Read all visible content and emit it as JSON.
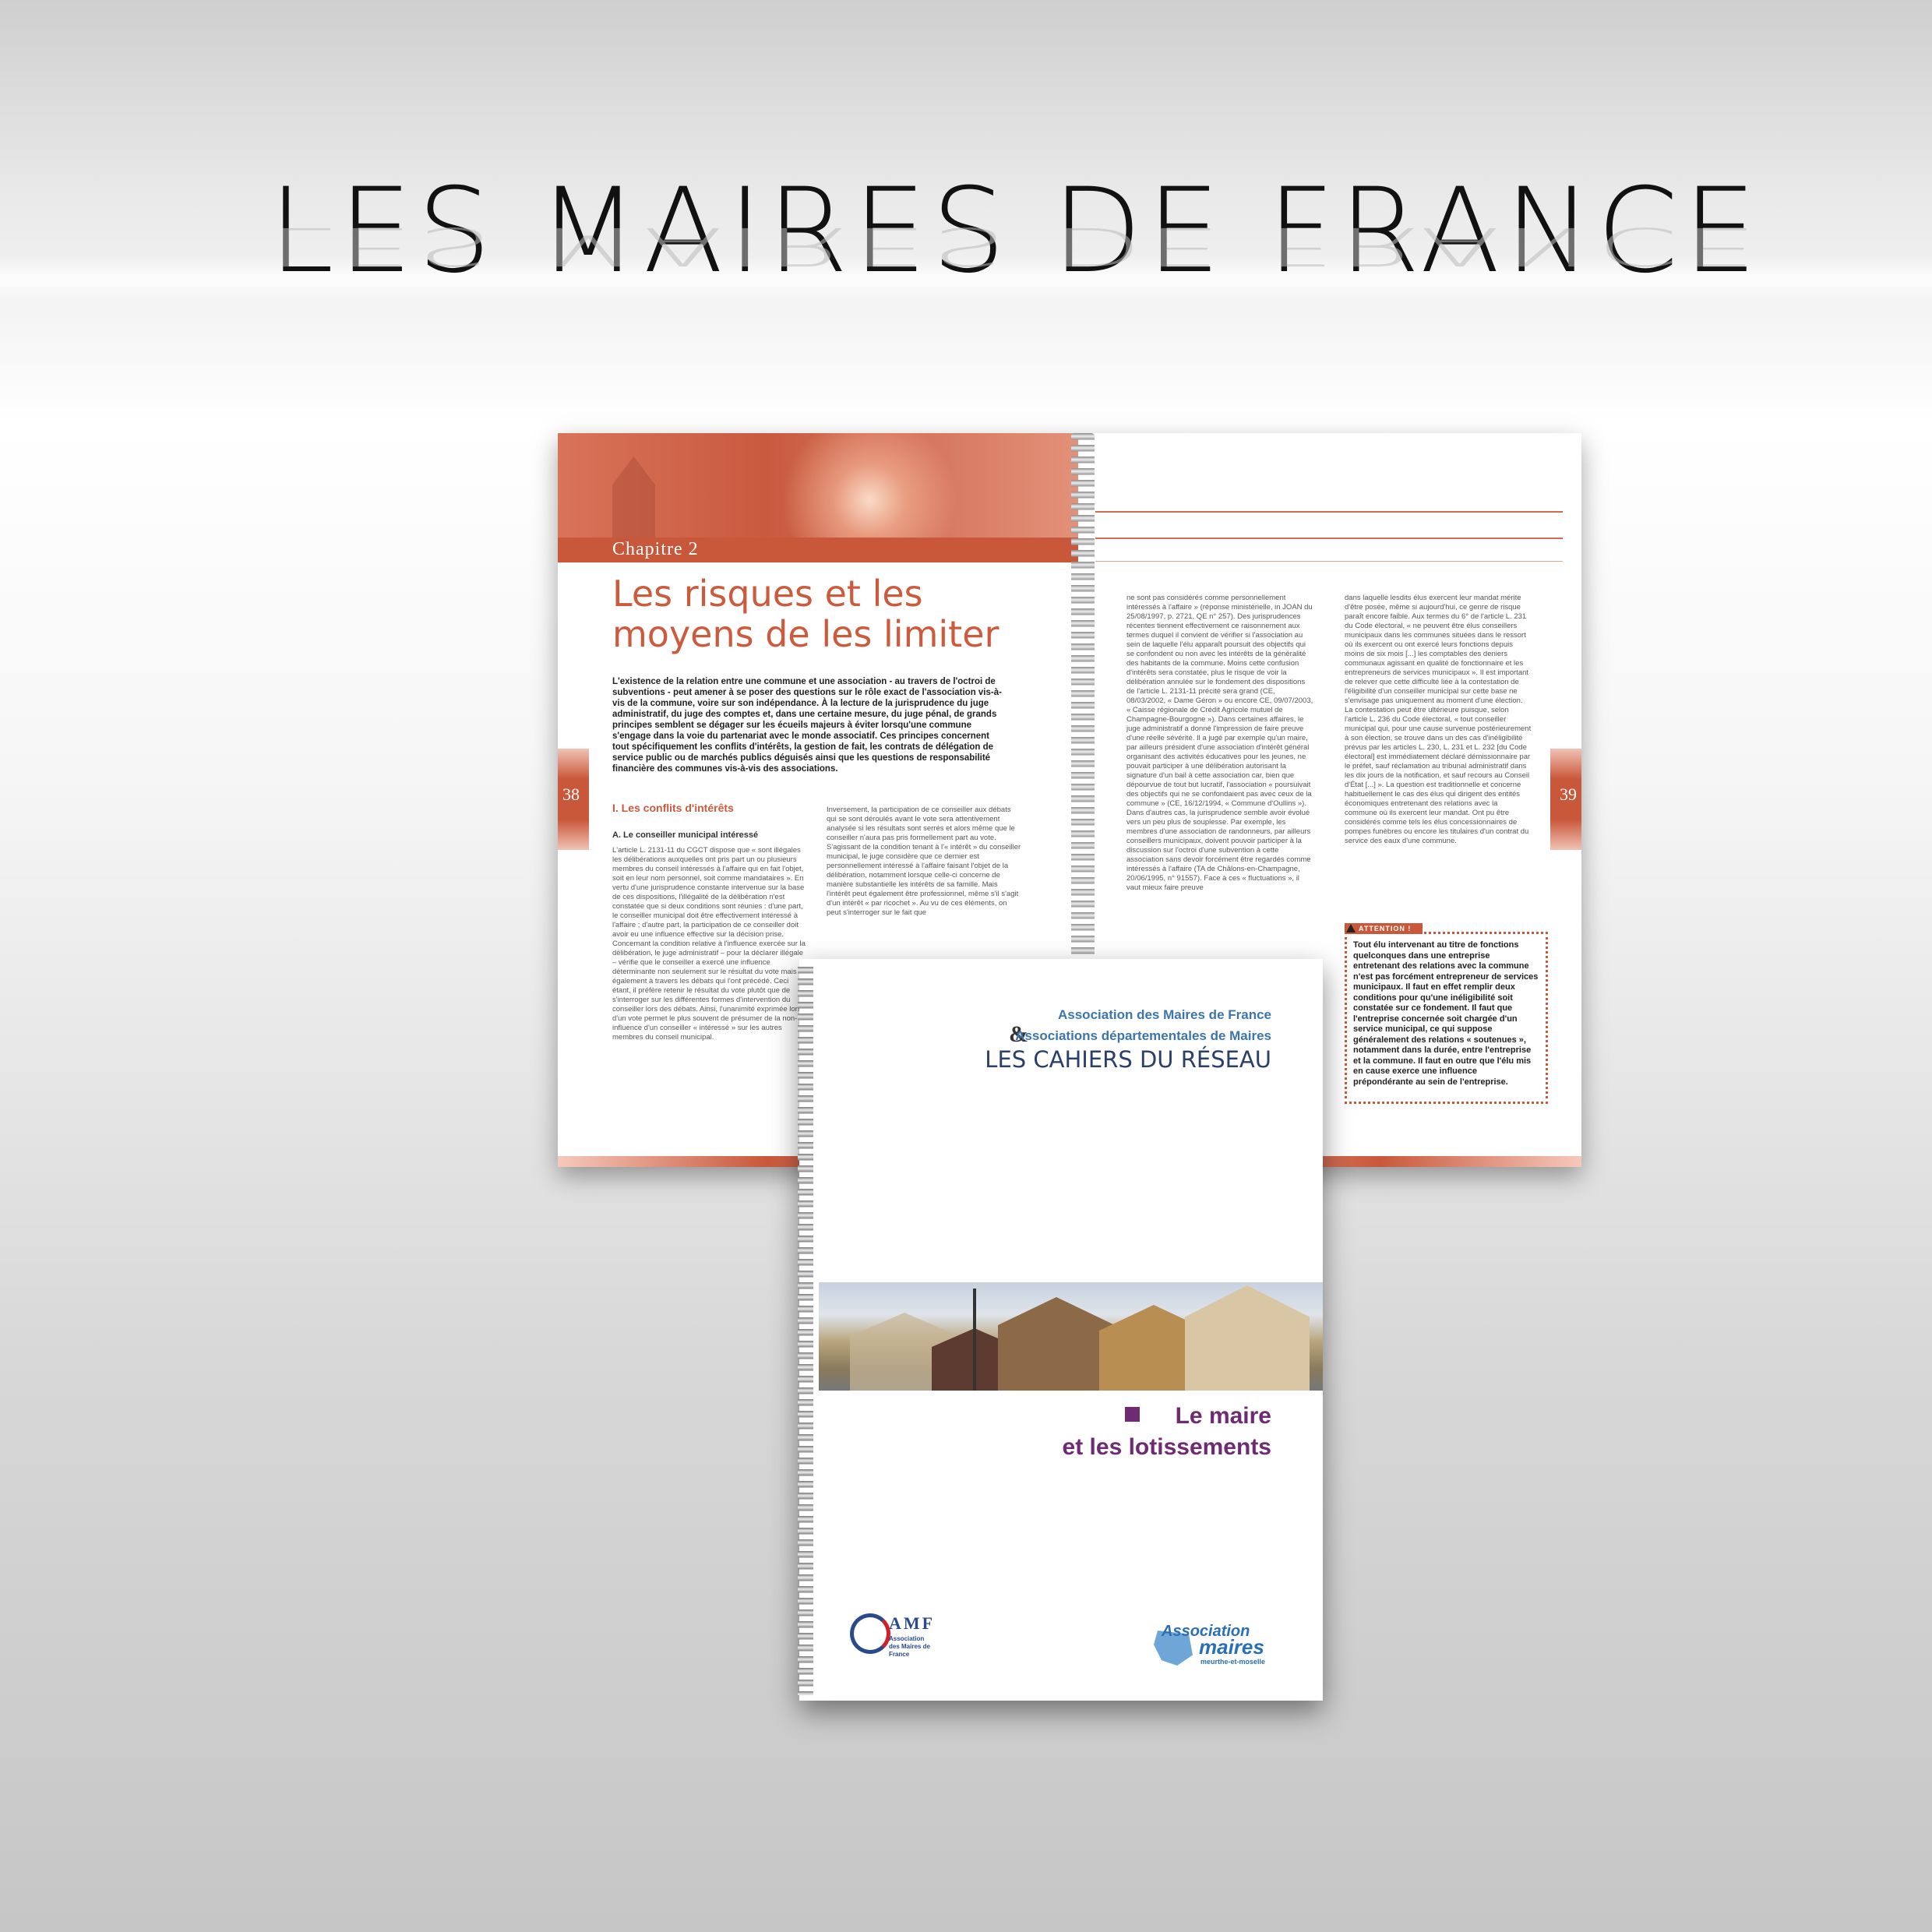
{
  "headline": "LES MAIRES DE FRANCE",
  "spread": {
    "chapter": "Chapitre 2",
    "title": "Les risques et les moyens de les limiter",
    "intro": "L'existence de la relation entre une commune et une association - au travers de l'octroi de subventions - peut amener à se poser des questions sur le rôle exact de l'association vis-à-vis de la commune, voire sur son indépendance. À la lecture de la jurisprudence du juge administratif, du juge des comptes et, dans une certaine mesure, du juge pénal, de grands principes semblent se dégager sur les écueils majeurs à éviter lorsqu'une commune s'engage dans la voie du partenariat avec le monde associatif. Ces principes concernent tout spécifiquement les conflits d'intérêts, la gestion de fait, les contrats de délégation de service public ou de marchés publics déguisés ainsi que les questions de responsabilité financière des communes vis-à-vis des associations.",
    "page_left": "38",
    "page_right": "39",
    "section": "I. Les conflits d'intérêts",
    "subsection": "A. Le conseiller municipal intéressé",
    "col1": "L'article L. 2131-11 du CGCT dispose que « sont illégales les délibérations auxquelles ont pris part un ou plusieurs membres du conseil intéressés à l'affaire qui en fait l'objet, soit en leur nom personnel, soit comme mandataires ». En vertu d'une jurisprudence constante intervenue sur la base de ces dispositions, l'illégalité de la délibération n'est constatée que si deux conditions sont réunies : d'une part, le conseiller municipal doit être effectivement intéressé à l'affaire ; d'autre part, la participation de ce conseiller doit avoir eu une influence effective sur la décision prise. Concernant la condition relative à l'influence exercée sur la délibération, le juge administratif – pour la déclarer illégale – vérifie que le conseiller a exercé une influence déterminante non seulement sur le résultat du vote mais également à travers les débats qui l'ont précédé. Ceci étant, il préfère retenir le résultat du vote plutôt que de s'interroger sur les différentes formes d'intervention du conseiller lors des débats. Ainsi, l'unanimité exprimée lors d'un vote permet le plus souvent de présumer de la non-influence d'un conseiller « intéressé » sur les autres membres du conseil municipal.",
    "col2": "Inversement, la participation de ce conseiller aux débats qui se sont déroulés avant le vote sera attentivement analysée si les résultats sont serrés et alors même que le conseiller n'aura pas pris formellement part au vote. S'agissant de la condition tenant à l'« intérêt » du conseiller municipal, le juge considère que ce dernier est personnellement intéressé à l'affaire faisant l'objet de la délibération, notamment lorsque celle-ci concerne de manière substantielle les intérêts de sa famille. Mais l'intérêt peut également être professionnel, même s'il s'agit d'un intérêt « par ricochet ». Au vu de ces éléments, on peut s'interroger sur le fait que",
    "col3": "ne sont pas considérés comme personnellement intéressés à l'affaire » (réponse ministérielle, in JOAN du 25/08/1997, p. 2721, QE n° 257). Des jurisprudences récentes tiennent effectivement ce raisonnement aux termes duquel il convient de vérifier si l'association au sein de laquelle l'élu apparaît poursuit des objectifs qui se confondent ou non avec les intérêts de la généralité des habitants de la commune. Moins cette confusion d'intérêts sera constatée, plus le risque de voir la délibération annulée sur le fondement des dispositions de l'article L. 2131-11 précité sera grand (CE, 08/03/2002, « Dame Géron » ou encore CE, 09/07/2003, « Caisse régionale de Crédit Agricole mutuel de Champagne-Bourgogne »). Dans certaines affaires, le juge administratif a donné l'impression de faire preuve d'une réelle sévérité. Il a jugé par exemple qu'un maire, par ailleurs président d'une association d'intérêt général organisant des activités éducatives pour les jeunes, ne pouvait participer à une délibération autorisant la signature d'un bail à cette association car, bien que dépourvue de tout but lucratif, l'association « poursuivait des objectifs qui ne se confondaient pas avec ceux de la commune » (CE, 16/12/1994, « Commune d'Oullins »). Dans d'autres cas, la jurisprudence semble avoir évolué vers un peu plus de souplesse. Par exemple, les membres d'une association de randonneurs, par ailleurs conseillers municipaux, doivent pouvoir participer à la discussion sur l'octroi d'une subvention à cette association sans devoir forcément être regardés comme intéressés à l'affaire (TA de Châlons-en-Champagne, 20/06/1995, n° 91557). Face à ces « fluctuations », il vaut mieux faire preuve",
    "col4": "dans laquelle lesdits élus exercent leur mandat mérite d'être posée, même si aujourd'hui, ce genre de risque paraît encore faible. Aux termes du 6° de l'article L. 231 du Code électoral, « ne peuvent être élus conseillers municipaux dans les communes situées dans le ressort où ils exercent ou ont exercé leurs fonctions depuis moins de six mois [...] les comptables des deniers communaux agissant en qualité de fonctionnaire et les entrepreneurs de services municipaux ». Il est important de relever que cette difficulté liée à la contestation de l'éligibilité d'un conseiller municipal sur cette base ne s'envisage pas uniquement au moment d'une élection. La contestation peut être ultérieure puisque, selon l'article L. 236 du Code électoral, « tout conseiller municipal qui, pour une cause survenue postérieurement à son élection, se trouve dans un des cas d'inéligibilité prévus par les articles L. 230, L. 231 et L. 232 [du Code électoral] est immédiatement déclaré démissionnaire par le préfet, sauf réclamation au tribunal administratif dans les dix jours de la notification, et sauf recours au Conseil d'État [...] ». La question est traditionnelle et concerne habituellement le cas des élus qui dirigent des entités économiques entretenant des relations avec la commune où ils exercent leur mandat. Ont pu être considérés comme tels les élus concessionnaires de pompes funèbres ou encore les titulaires d'un contrat du service des eaux d'une commune.",
    "attention_label": "ATTENTION !",
    "attention_text": "Tout élu intervenant au titre de fonctions quelconques dans une entreprise entretenant des relations avec la commune n'est pas forcément entrepreneur de services municipaux. Il faut en effet remplir deux conditions pour qu'une inéligibilité soit constatée sur ce fondement. Il faut que l'entreprise concernée soit chargée d'un service municipal, ce qui suppose généralement des relations « soutenues », notamment dans la durée, entre l'entreprise et la commune. Il faut en outre que l'élu mis en cause exerce une influence prépondérante au sein de l'entreprise."
  },
  "cover": {
    "ampersand": "&",
    "association_line1": "Association des Maires de France",
    "association_line2": "Associations départementales de Maires",
    "series": "LES CAHIERS DU RÉSEAU",
    "subject_line1": "Le maire",
    "subject_line2": "et les lotissements",
    "amf_letters": "AMF",
    "amf_sub1": "Association",
    "amf_sub2": "des Maires de France",
    "mm_a": "Association",
    "mm_b": "maires",
    "mm_c": "meurthe-et-moselle"
  },
  "colors": {
    "accent": "#c9583b",
    "cover_title": "#2a3f6a",
    "cover_assoc": "#3c75ae",
    "cover_subject": "#6e2a73"
  }
}
